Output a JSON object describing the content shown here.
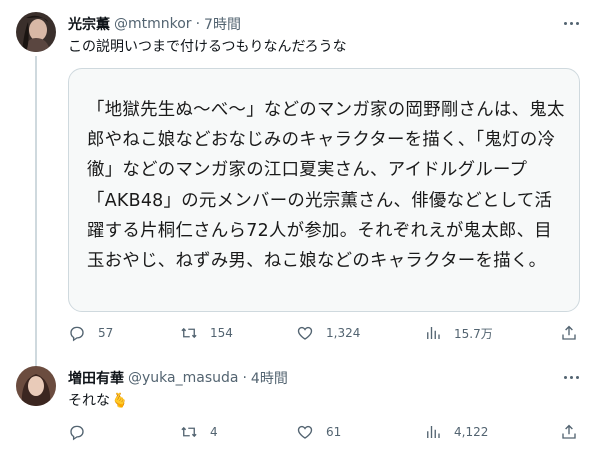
{
  "colors": {
    "text": "#0f1419",
    "muted": "#536471",
    "border": "#cfd9de",
    "card_bg": "#f7f9f9"
  },
  "tweet1": {
    "name": "光宗薫",
    "handle": "@mtmnkor",
    "separator": "·",
    "time": "7時間",
    "text": "この説明いつまで付けるつもりなんだろうな",
    "quote_image_text": "「地獄先生ぬ〜べ〜」などのマンガ家の岡野剛さんは、鬼太郎やねこ娘などおなじみのキャラクターを描く、「鬼灯の冷徹」などのマンガ家の江口夏実さん、アイドルグループ「AKB48」の元メンバーの光宗薫さん、俳優などとして活躍する片桐仁さんら72人が参加。それぞれえが鬼太郎、目玉おやじ、ねずみ男、ねこ娘などのキャラクターを描く。",
    "counts": {
      "replies": "57",
      "retweets": "154",
      "likes": "1,324",
      "views": "15.7万"
    }
  },
  "tweet2": {
    "name": "増田有華",
    "handle": "@yuka_masuda",
    "separator": "·",
    "time": "4時間",
    "text": "それな",
    "emoji": "🫰",
    "counts": {
      "replies": "",
      "retweets": "4",
      "likes": "61",
      "views": "4,122"
    }
  },
  "icons": [
    "more-icon",
    "reply-icon",
    "retweet-icon",
    "like-icon",
    "views-icon",
    "share-icon"
  ]
}
